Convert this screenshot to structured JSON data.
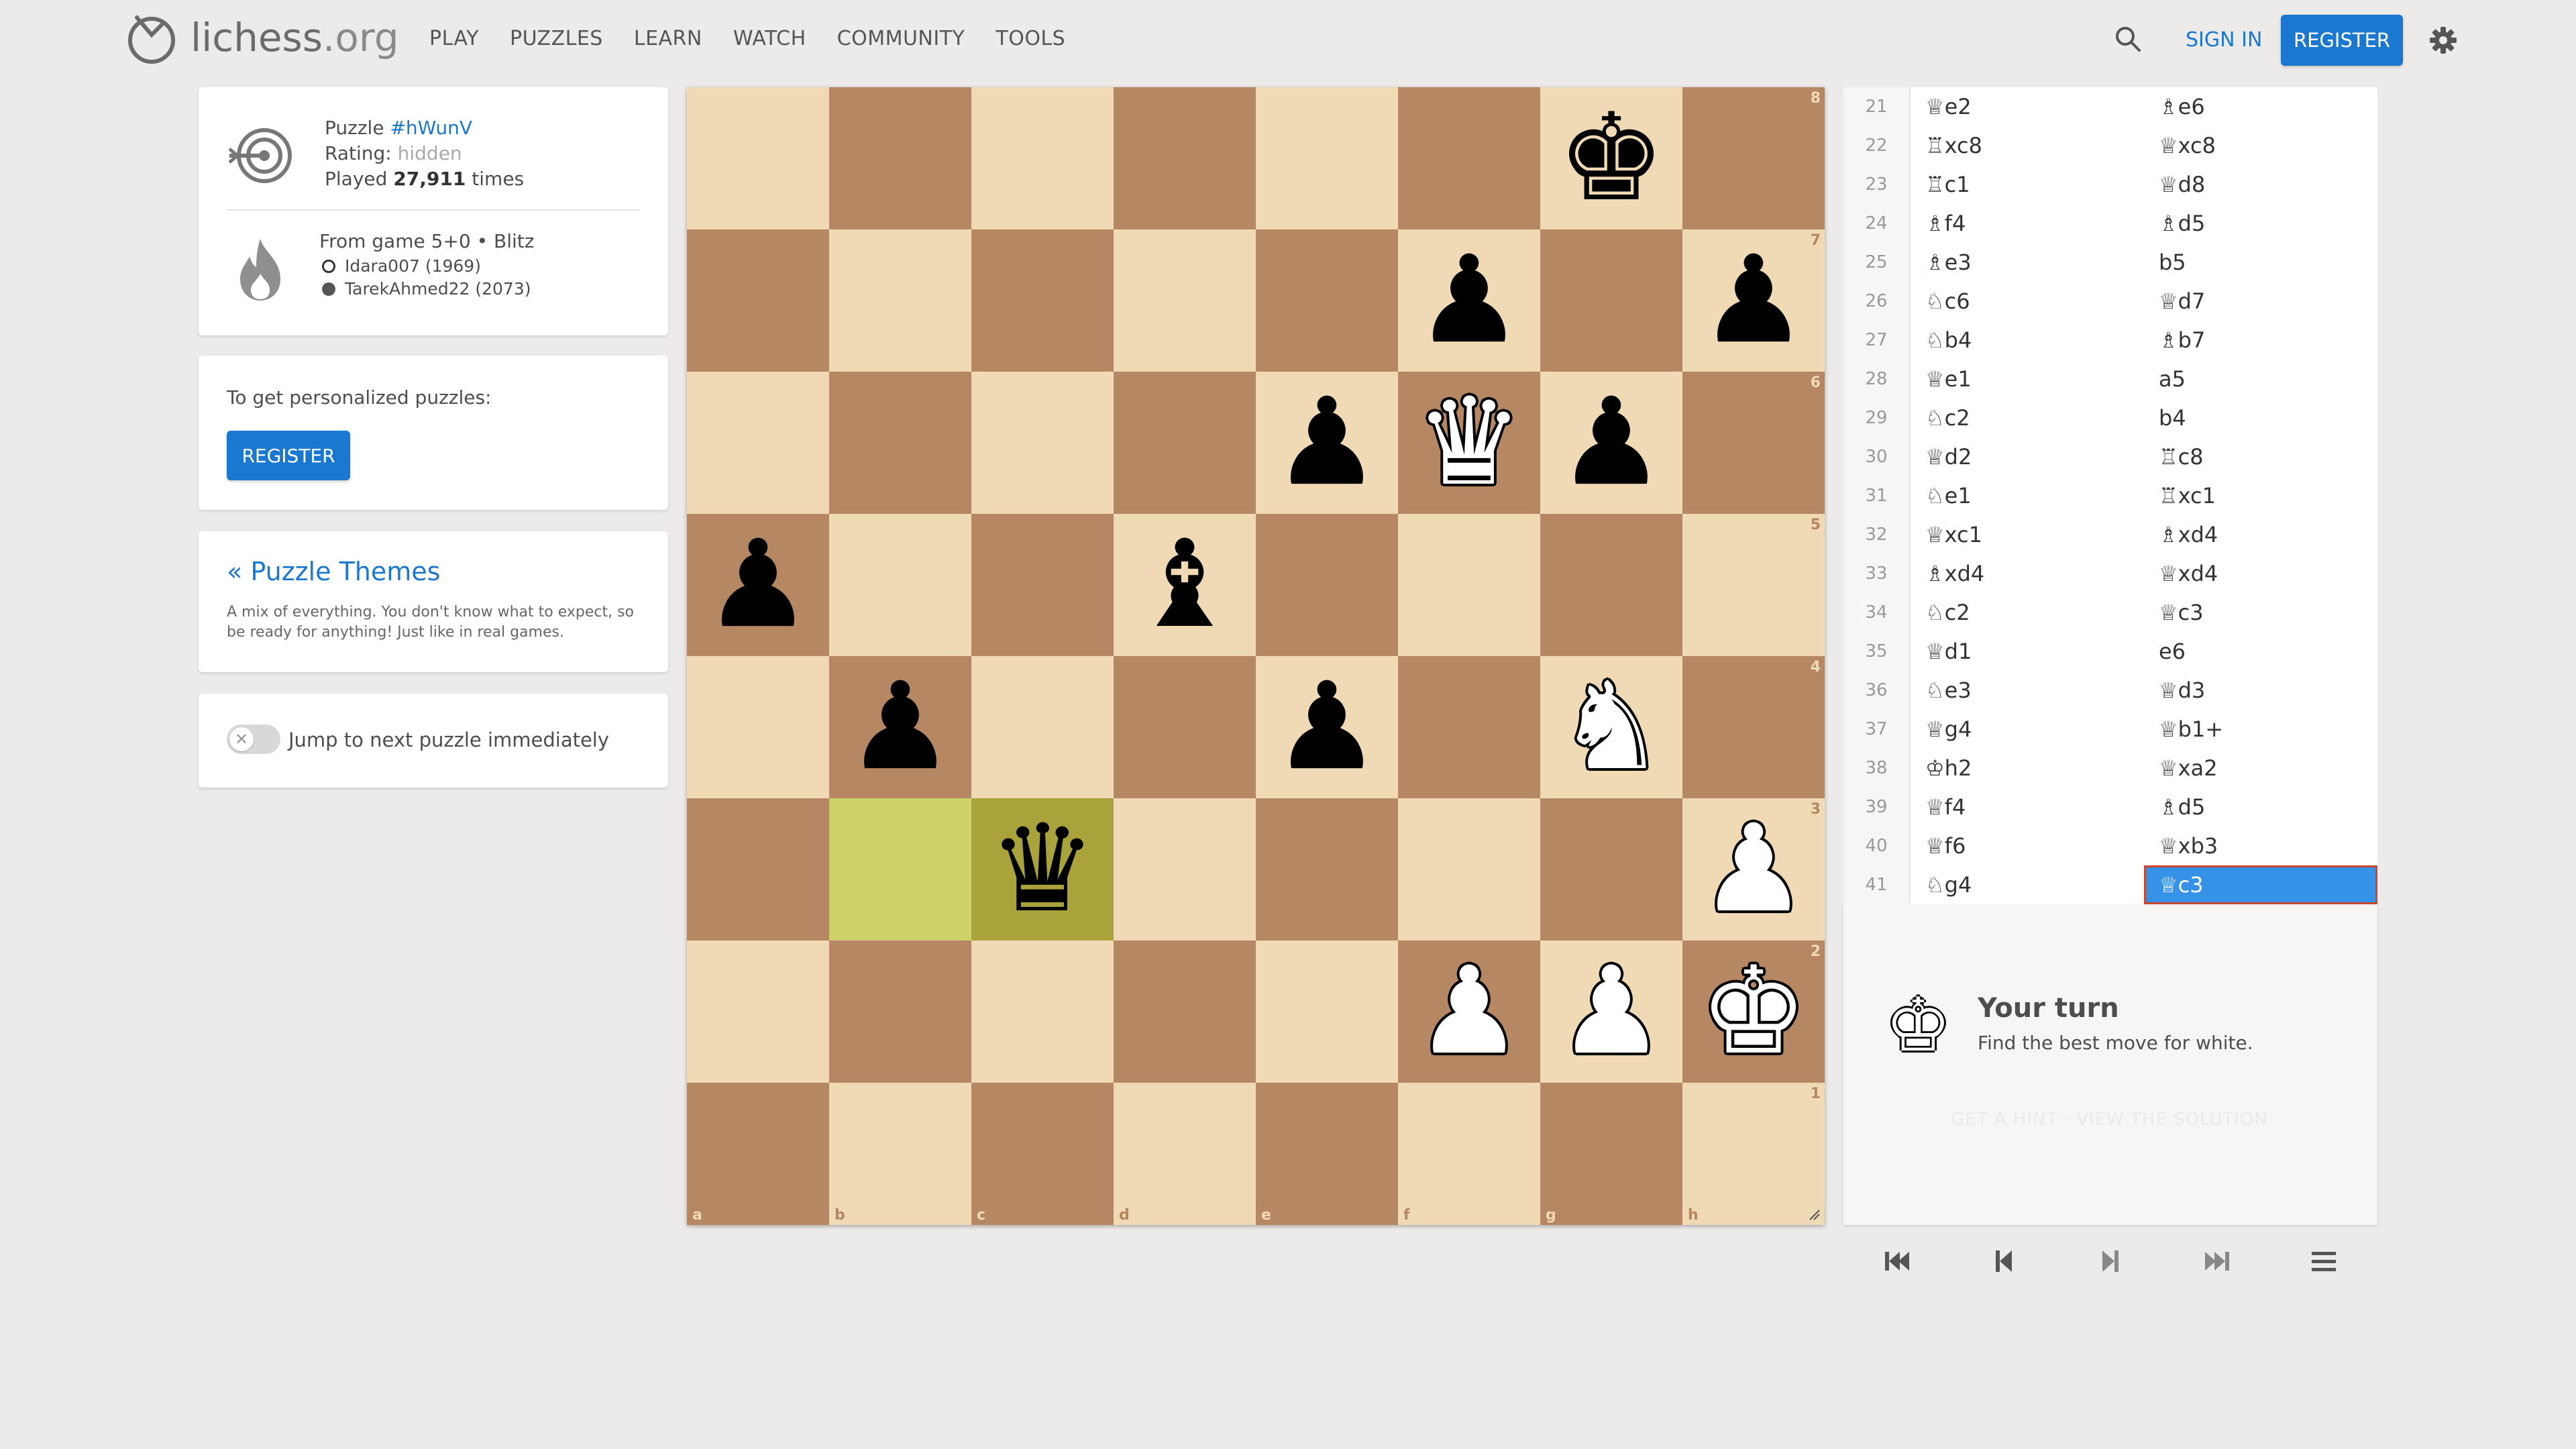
{
  "header": {
    "logo_main": "lichess",
    "logo_tld": ".org",
    "nav": [
      "PLAY",
      "PUZZLES",
      "LEARN",
      "WATCH",
      "COMMUNITY",
      "TOOLS"
    ],
    "sign_in": "SIGN IN",
    "register": "REGISTER"
  },
  "puzzle": {
    "label": "Puzzle",
    "id": "#hWunV",
    "rating_label": "Rating:",
    "rating_value": "hidden",
    "played_prefix": "Played",
    "played_count": "27,911",
    "played_suffix": "times",
    "game": "From game 5+0 • Blitz",
    "white_player": "Idara007 (1969)",
    "black_player": "TarekAhmed22 (2073)"
  },
  "register_box": {
    "text": "To get personalized puzzles:",
    "button": "REGISTER"
  },
  "themes": {
    "link": "« Puzzle Themes",
    "description": "A mix of everything. You don't know what to expect, so be ready for anything! Just like in real games."
  },
  "jump": {
    "label": "Jump to next puzzle immediately",
    "enabled": false
  },
  "board": {
    "files": [
      "a",
      "b",
      "c",
      "d",
      "e",
      "f",
      "g",
      "h"
    ],
    "ranks": [
      "8",
      "7",
      "6",
      "5",
      "4",
      "3",
      "2",
      "1"
    ],
    "position": [
      [
        "",
        "",
        "",
        "",
        "",
        "",
        "bK",
        ""
      ],
      [
        "",
        "",
        "",
        "",
        "",
        "bP",
        "",
        "bP"
      ],
      [
        "",
        "",
        "",
        "",
        "bP",
        "wQ",
        "bP",
        ""
      ],
      [
        "bP",
        "",
        "",
        "bB",
        "",
        "",
        "",
        ""
      ],
      [
        "",
        "bP",
        "",
        "",
        "bP",
        "",
        "wN",
        ""
      ],
      [
        "",
        "",
        "bQ",
        "",
        "",
        "",
        "",
        "wP"
      ],
      [
        "",
        "",
        "",
        "",
        "",
        "wP",
        "wP",
        "wK"
      ],
      [
        "",
        "",
        "",
        "",
        "",
        "",
        "",
        ""
      ]
    ],
    "last_move": [
      "b3",
      "c3"
    ],
    "colors": {
      "light": "#f0d9b5",
      "dark": "#b58863",
      "highlight_light": "#cdd26a",
      "highlight_dark": "#aaa23a"
    }
  },
  "moves": [
    {
      "n": "21",
      "w": "♕e2",
      "b": "♗e6"
    },
    {
      "n": "22",
      "w": "♖xc8",
      "b": "♕xc8"
    },
    {
      "n": "23",
      "w": "♖c1",
      "b": "♕d8"
    },
    {
      "n": "24",
      "w": "♗f4",
      "b": "♗d5"
    },
    {
      "n": "25",
      "w": "♗e3",
      "b": "b5"
    },
    {
      "n": "26",
      "w": "♘c6",
      "b": "♕d7"
    },
    {
      "n": "27",
      "w": "♘b4",
      "b": "♗b7"
    },
    {
      "n": "28",
      "w": "♕e1",
      "b": "a5"
    },
    {
      "n": "29",
      "w": "♘c2",
      "b": "b4"
    },
    {
      "n": "30",
      "w": "♕d2",
      "b": "♖c8"
    },
    {
      "n": "31",
      "w": "♘e1",
      "b": "♖xc1"
    },
    {
      "n": "32",
      "w": "♕xc1",
      "b": "♗xd4"
    },
    {
      "n": "33",
      "w": "♗xd4",
      "b": "♕xd4"
    },
    {
      "n": "34",
      "w": "♘c2",
      "b": "♕c3"
    },
    {
      "n": "35",
      "w": "♕d1",
      "b": "e6"
    },
    {
      "n": "36",
      "w": "♘e3",
      "b": "♕d3"
    },
    {
      "n": "37",
      "w": "♕g4",
      "b": "♕b1+"
    },
    {
      "n": "38",
      "w": "♔h2",
      "b": "♕xa2"
    },
    {
      "n": "39",
      "w": "♕f4",
      "b": "♗d5"
    },
    {
      "n": "40",
      "w": "♕f6",
      "b": "♕xb3"
    },
    {
      "n": "41",
      "w": "♘g4",
      "b": "♕c3"
    }
  ],
  "active_move": {
    "n": "41",
    "side": "b"
  },
  "turn": {
    "title": "Your turn",
    "subtitle": "Find the best move for white.",
    "ghost": "GET A HINT   ·   VIEW THE SOLUTION"
  },
  "colors": {
    "accent": "#1b78d0",
    "active_move": "#3692e7"
  },
  "controls": [
    "first-icon",
    "prev-icon",
    "next-icon",
    "last-icon",
    "menu-icon"
  ]
}
